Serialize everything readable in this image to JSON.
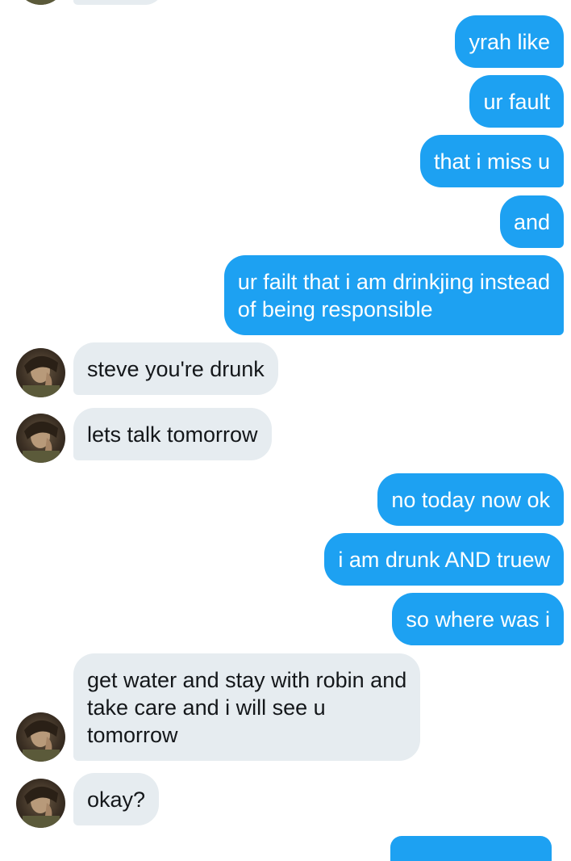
{
  "conversation": {
    "messages": [
      {
        "sender": "me",
        "text": "yrah like"
      },
      {
        "sender": "me",
        "text": "ur fault"
      },
      {
        "sender": "me",
        "text": "that i miss u"
      },
      {
        "sender": "me",
        "text": "and"
      },
      {
        "sender": "me",
        "text": "ur failt that i am drinkjing instead\nof being responsible"
      },
      {
        "sender": "them",
        "text": "steve you're drunk"
      },
      {
        "sender": "them",
        "text": "lets talk tomorrow"
      },
      {
        "sender": "me",
        "text": "no today now ok"
      },
      {
        "sender": "me",
        "text": "i am drunk AND truew"
      },
      {
        "sender": "me",
        "text": "so where was i"
      },
      {
        "sender": "them",
        "text": "get water and stay with robin and\ntake care and i will see u\ntomorrow"
      },
      {
        "sender": "them",
        "text": "okay?"
      }
    ]
  },
  "colors": {
    "outgoing_bubble": "#1da1f2",
    "incoming_bubble": "#e6ecf0",
    "background": "#ffffff"
  },
  "icons": {
    "contact_avatar": "avatar"
  }
}
